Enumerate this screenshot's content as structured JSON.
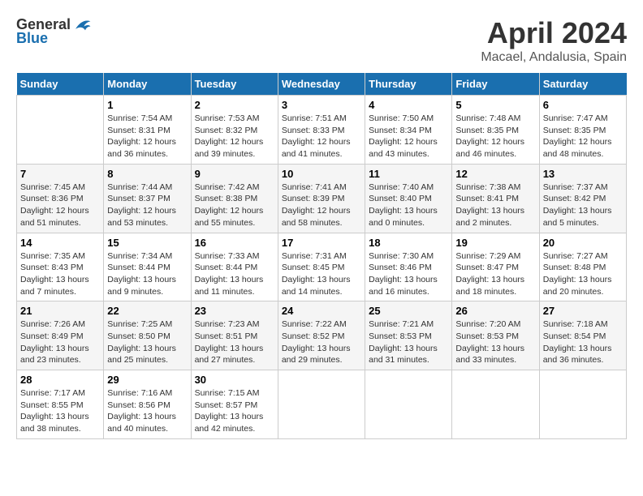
{
  "header": {
    "logo_general": "General",
    "logo_blue": "Blue",
    "title": "April 2024",
    "subtitle": "Macael, Andalusia, Spain"
  },
  "calendar": {
    "days_of_week": [
      "Sunday",
      "Monday",
      "Tuesday",
      "Wednesday",
      "Thursday",
      "Friday",
      "Saturday"
    ],
    "weeks": [
      [
        {
          "day": "",
          "info": ""
        },
        {
          "day": "1",
          "info": "Sunrise: 7:54 AM\nSunset: 8:31 PM\nDaylight: 12 hours\nand 36 minutes."
        },
        {
          "day": "2",
          "info": "Sunrise: 7:53 AM\nSunset: 8:32 PM\nDaylight: 12 hours\nand 39 minutes."
        },
        {
          "day": "3",
          "info": "Sunrise: 7:51 AM\nSunset: 8:33 PM\nDaylight: 12 hours\nand 41 minutes."
        },
        {
          "day": "4",
          "info": "Sunrise: 7:50 AM\nSunset: 8:34 PM\nDaylight: 12 hours\nand 43 minutes."
        },
        {
          "day": "5",
          "info": "Sunrise: 7:48 AM\nSunset: 8:35 PM\nDaylight: 12 hours\nand 46 minutes."
        },
        {
          "day": "6",
          "info": "Sunrise: 7:47 AM\nSunset: 8:35 PM\nDaylight: 12 hours\nand 48 minutes."
        }
      ],
      [
        {
          "day": "7",
          "info": "Sunrise: 7:45 AM\nSunset: 8:36 PM\nDaylight: 12 hours\nand 51 minutes."
        },
        {
          "day": "8",
          "info": "Sunrise: 7:44 AM\nSunset: 8:37 PM\nDaylight: 12 hours\nand 53 minutes."
        },
        {
          "day": "9",
          "info": "Sunrise: 7:42 AM\nSunset: 8:38 PM\nDaylight: 12 hours\nand 55 minutes."
        },
        {
          "day": "10",
          "info": "Sunrise: 7:41 AM\nSunset: 8:39 PM\nDaylight: 12 hours\nand 58 minutes."
        },
        {
          "day": "11",
          "info": "Sunrise: 7:40 AM\nSunset: 8:40 PM\nDaylight: 13 hours\nand 0 minutes."
        },
        {
          "day": "12",
          "info": "Sunrise: 7:38 AM\nSunset: 8:41 PM\nDaylight: 13 hours\nand 2 minutes."
        },
        {
          "day": "13",
          "info": "Sunrise: 7:37 AM\nSunset: 8:42 PM\nDaylight: 13 hours\nand 5 minutes."
        }
      ],
      [
        {
          "day": "14",
          "info": "Sunrise: 7:35 AM\nSunset: 8:43 PM\nDaylight: 13 hours\nand 7 minutes."
        },
        {
          "day": "15",
          "info": "Sunrise: 7:34 AM\nSunset: 8:44 PM\nDaylight: 13 hours\nand 9 minutes."
        },
        {
          "day": "16",
          "info": "Sunrise: 7:33 AM\nSunset: 8:44 PM\nDaylight: 13 hours\nand 11 minutes."
        },
        {
          "day": "17",
          "info": "Sunrise: 7:31 AM\nSunset: 8:45 PM\nDaylight: 13 hours\nand 14 minutes."
        },
        {
          "day": "18",
          "info": "Sunrise: 7:30 AM\nSunset: 8:46 PM\nDaylight: 13 hours\nand 16 minutes."
        },
        {
          "day": "19",
          "info": "Sunrise: 7:29 AM\nSunset: 8:47 PM\nDaylight: 13 hours\nand 18 minutes."
        },
        {
          "day": "20",
          "info": "Sunrise: 7:27 AM\nSunset: 8:48 PM\nDaylight: 13 hours\nand 20 minutes."
        }
      ],
      [
        {
          "day": "21",
          "info": "Sunrise: 7:26 AM\nSunset: 8:49 PM\nDaylight: 13 hours\nand 23 minutes."
        },
        {
          "day": "22",
          "info": "Sunrise: 7:25 AM\nSunset: 8:50 PM\nDaylight: 13 hours\nand 25 minutes."
        },
        {
          "day": "23",
          "info": "Sunrise: 7:23 AM\nSunset: 8:51 PM\nDaylight: 13 hours\nand 27 minutes."
        },
        {
          "day": "24",
          "info": "Sunrise: 7:22 AM\nSunset: 8:52 PM\nDaylight: 13 hours\nand 29 minutes."
        },
        {
          "day": "25",
          "info": "Sunrise: 7:21 AM\nSunset: 8:53 PM\nDaylight: 13 hours\nand 31 minutes."
        },
        {
          "day": "26",
          "info": "Sunrise: 7:20 AM\nSunset: 8:53 PM\nDaylight: 13 hours\nand 33 minutes."
        },
        {
          "day": "27",
          "info": "Sunrise: 7:18 AM\nSunset: 8:54 PM\nDaylight: 13 hours\nand 36 minutes."
        }
      ],
      [
        {
          "day": "28",
          "info": "Sunrise: 7:17 AM\nSunset: 8:55 PM\nDaylight: 13 hours\nand 38 minutes."
        },
        {
          "day": "29",
          "info": "Sunrise: 7:16 AM\nSunset: 8:56 PM\nDaylight: 13 hours\nand 40 minutes."
        },
        {
          "day": "30",
          "info": "Sunrise: 7:15 AM\nSunset: 8:57 PM\nDaylight: 13 hours\nand 42 minutes."
        },
        {
          "day": "",
          "info": ""
        },
        {
          "day": "",
          "info": ""
        },
        {
          "day": "",
          "info": ""
        },
        {
          "day": "",
          "info": ""
        }
      ]
    ]
  }
}
